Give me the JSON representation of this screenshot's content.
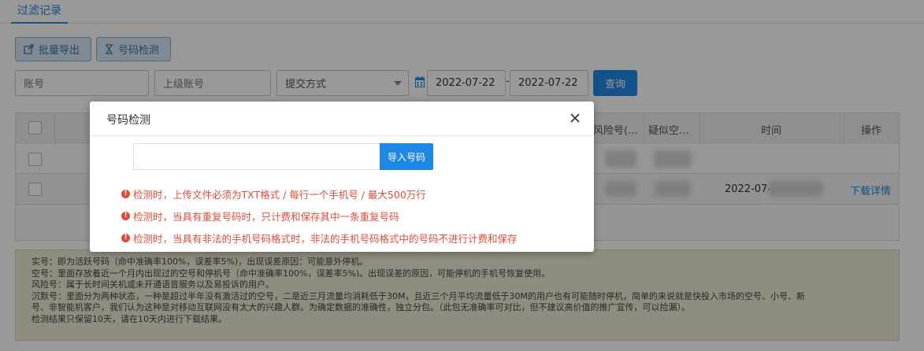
{
  "tab": {
    "label": "过滤记录"
  },
  "toolbar": {
    "export_label": "批量导出",
    "check_label": "号码检测"
  },
  "filters": {
    "account_placeholder": "账号",
    "parent_account_placeholder": "上级账号",
    "submit_method_value": "提交方式",
    "date_start": "2022-07-22",
    "date_separator": "-",
    "date_end": "2022-07-22",
    "query_label": "查询"
  },
  "table": {
    "headers": {
      "risk": "风险号(…",
      "suspect": "疑似空…",
      "time": "时间",
      "action": "操作"
    },
    "rows": [
      {
        "col1_partial": "",
        "time": "",
        "action": ""
      },
      {
        "col1_partial": "a",
        "time": "2022-07-2",
        "action": "下载详情"
      }
    ]
  },
  "notice": {
    "lines": [
      "实号：即为活跃号码（命中准确率100%，误差率5%)，出现误差原因：可能意外停机。",
      "空号：里面存放着近一个月内出现过的空号和停机号（命中准确率100%，误差率5%)。出现误差的原因，可能停机的手机号恢复使用。",
      "风险号：属于长时间关机或未开通语音服务以及易投诉的用户。",
      "沉默号：里面分为两种状态，一种是超过半年没有激活过的空号，二是近三月流量均消耗低于30M，且近三个月平均流量低于30M的用户也有可能随时停机，简单的来说就是快投入市场的空号、小号、新",
      "号、非智能机客户，我们认为这种是对移动互联网没有太大的兴趣人群。为确定数据的准确性，独立分包。（此包无准确率可对比，但不建议高价值的推广宣传，可以捡漏）。",
      "检测结果只保留10天，请在10天内进行下载结果。"
    ]
  },
  "modal": {
    "title": "号码检测",
    "import_label": "导入号码",
    "tips": [
      "检测时，上传文件必须为TXT格式 / 每行一个手机号 / 最大500万行",
      "检测时，当具有重复号码时，只计费和保存其中一条重复号码",
      "检测时，当具有非法的手机号码格式时，非法的手机号码格式中的号码不进行计费和保存"
    ],
    "tip_icon_glyph": "!"
  },
  "colors": {
    "accent": "#1e88e5",
    "danger": "#e04c3c",
    "notice_bg": "#efecd4"
  }
}
